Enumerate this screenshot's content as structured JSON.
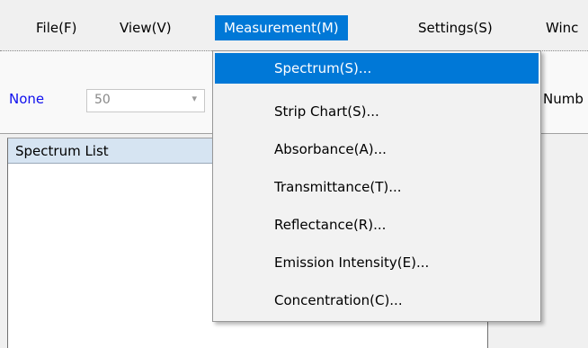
{
  "menubar": {
    "items": [
      {
        "label": "File(F)"
      },
      {
        "label": "View(V)"
      },
      {
        "label": "Measurement(M)"
      },
      {
        "label": "Settings(S)"
      },
      {
        "label": "Winc"
      }
    ]
  },
  "toolbar": {
    "none_label": "None",
    "combo_value": "50",
    "combo_arrow": "▾",
    "number_label": "Numb"
  },
  "panel": {
    "header": "Spectrum List"
  },
  "dropdown": {
    "items": [
      {
        "label": "Spectrum(S)..."
      },
      {
        "label": "Strip Chart(S)..."
      },
      {
        "label": "Absorbance(A)..."
      },
      {
        "label": "Transmittance(T)..."
      },
      {
        "label": "Reflectance(R)..."
      },
      {
        "label": "Emission Intensity(E)..."
      },
      {
        "label": "Concentration(C)..."
      }
    ]
  },
  "colors": {
    "accent": "#0078d7",
    "none_label": "#1010ee",
    "panel_header": "#d6e4f2"
  }
}
